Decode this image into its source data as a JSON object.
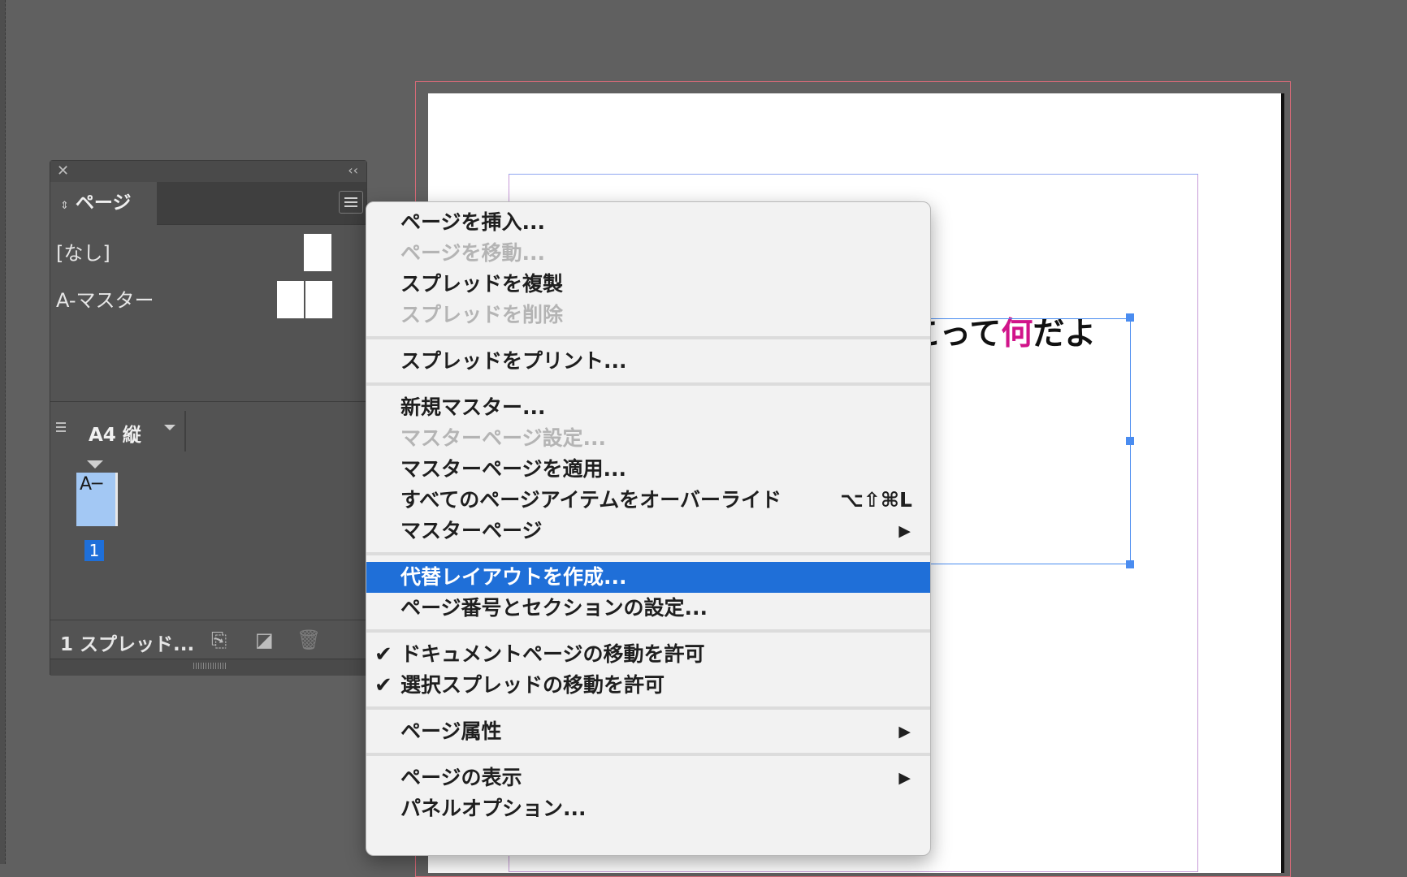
{
  "document": {
    "frame_text_prefix": "こって",
    "frame_text_accent": "何",
    "frame_text_suffix": "だよ",
    "accent_color": "#d1148a"
  },
  "pages_panel": {
    "close_icon": "close-icon",
    "collapse_icon": "collapse-icon",
    "tab_label": "ページ",
    "masters": [
      {
        "label": "[なし]"
      },
      {
        "label": "A-マスター"
      }
    ],
    "page_size": "A4 縦",
    "page_thumb_label": "A─",
    "page_number": "1",
    "spread_count": "1 スプレッド...",
    "footer_icons": [
      "edit-page-size-icon",
      "new-page-icon",
      "delete-page-icon"
    ]
  },
  "context_menu": {
    "groups": [
      [
        {
          "label": "ページを挿入...",
          "disabled": false
        },
        {
          "label": "ページを移動...",
          "disabled": true
        },
        {
          "label": "スプレッドを複製",
          "disabled": false
        },
        {
          "label": "スプレッドを削除",
          "disabled": true
        }
      ],
      [
        {
          "label": "スプレッドをプリント...",
          "disabled": false
        }
      ],
      [
        {
          "label": "新規マスター...",
          "disabled": false
        },
        {
          "label": "マスターページ設定...",
          "disabled": true
        },
        {
          "label": "マスターページを適用...",
          "disabled": false
        },
        {
          "label": "すべてのページアイテムをオーバーライド",
          "disabled": false,
          "shortcut": "⌥⇧⌘L"
        },
        {
          "label": "マスターページ",
          "disabled": false,
          "submenu": true
        }
      ],
      [
        {
          "label": "代替レイアウトを作成...",
          "disabled": false,
          "selected": true
        },
        {
          "label": "ページ番号とセクションの設定...",
          "disabled": false
        }
      ],
      [
        {
          "label": "ドキュメントページの移動を許可",
          "disabled": false,
          "checked": true
        },
        {
          "label": "選択スプレッドの移動を許可",
          "disabled": false,
          "checked": true
        }
      ],
      [
        {
          "label": "ページ属性",
          "disabled": false,
          "submenu": true
        }
      ],
      [
        {
          "label": "ページの表示",
          "disabled": false,
          "submenu": true
        },
        {
          "label": "パネルオプション...",
          "disabled": false
        }
      ]
    ],
    "check_glyph": "✔",
    "submenu_glyph": "▶",
    "selected_color": "#1f6fd8"
  }
}
